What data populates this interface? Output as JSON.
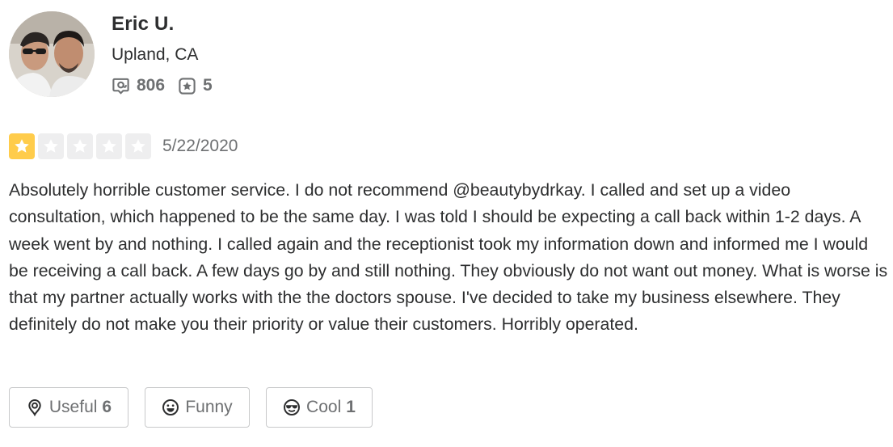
{
  "user": {
    "name": "Eric U.",
    "location": "Upland, CA",
    "stats": {
      "reviews_count": "806",
      "reviews_icon": "review-icon",
      "photos_count": "5",
      "photos_icon": "star-badge-icon"
    }
  },
  "review": {
    "rating": 1,
    "rating_max": 5,
    "rating_color": "#ffcc4b",
    "empty_star_color": "#eeeeef",
    "date": "5/22/2020",
    "text": "Absolutely horrible customer service. I do not recommend @beautybydrkay. I called and set up a video consultation, which happened to be the same day. I was told I should be expecting a call back within 1-2 days. A week went by and nothing. I called again and the receptionist took my information down and informed me I would be receiving a call back. A few days go by and still nothing. They obviously do not want out money. What is worse is that my partner actually works with the the doctors spouse. I've decided to take my business elsewhere. They definitely do not make you their priority or value their customers. Horribly operated."
  },
  "reactions": {
    "useful": {
      "label": "Useful",
      "count": "6",
      "icon": "lightbulb-icon"
    },
    "funny": {
      "label": "Funny",
      "count": "",
      "icon": "smiley-icon"
    },
    "cool": {
      "label": "Cool",
      "count": "1",
      "icon": "sunglasses-face-icon"
    }
  }
}
